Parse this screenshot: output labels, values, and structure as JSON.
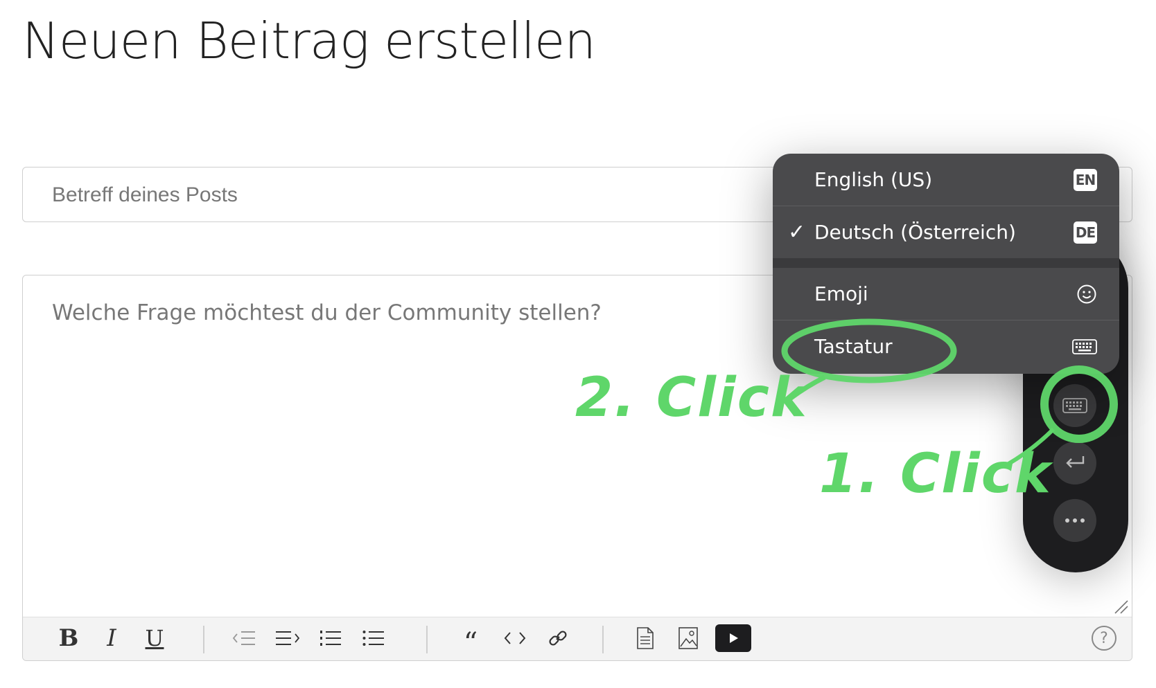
{
  "page": {
    "title": "Neuen Beitrag erstellen"
  },
  "form": {
    "subject_placeholder": "Betreff deines Posts",
    "body_placeholder": "Welche Frage möchtest du der Community stellen?"
  },
  "toolbar": {
    "bold": "B",
    "italic": "I",
    "underline": "U",
    "quote": "“",
    "help": "?"
  },
  "input_menu": {
    "items": [
      {
        "label": "English (US)",
        "badge": "EN",
        "checked": false
      },
      {
        "label": "Deutsch (Österreich)",
        "badge": "DE",
        "checked": true,
        "check": "✓"
      },
      {
        "label": "Emoji",
        "icon": "smiley-icon"
      },
      {
        "label": "Tastatur",
        "icon": "keyboard-icon"
      }
    ]
  },
  "annotations": {
    "step1": "1. Click",
    "step2": "2. Click",
    "color": "#5fd66a"
  }
}
